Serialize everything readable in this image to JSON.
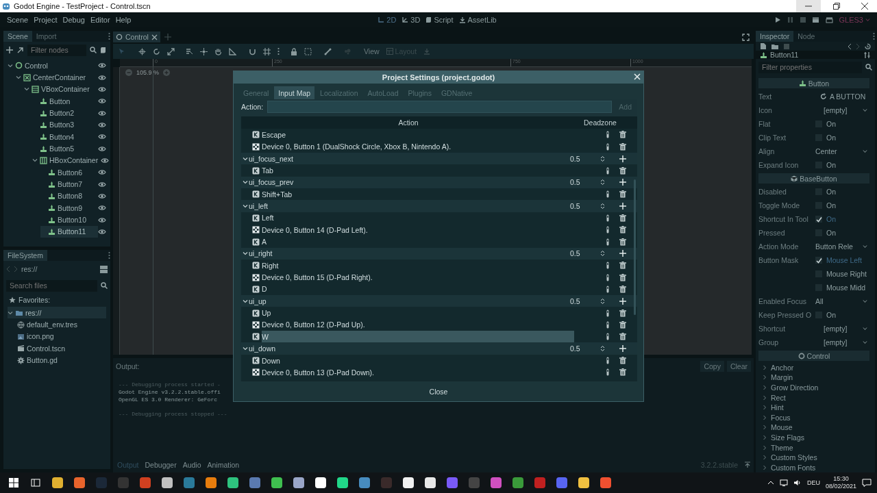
{
  "window": {
    "title": "Godot Engine - TestProject - Control.tscn"
  },
  "menu": [
    "Scene",
    "Project",
    "Debug",
    "Editor",
    "Help"
  ],
  "workspaces": [
    {
      "label": "2D",
      "kind": "planar",
      "selected": true
    },
    {
      "label": "3D",
      "kind": "spatial",
      "selected": false
    },
    {
      "label": "Script",
      "kind": "script",
      "selected": false
    },
    {
      "label": "AssetLib",
      "kind": "assetlib",
      "selected": false
    }
  ],
  "renderer": "GLES3",
  "scene_dock": {
    "tabs": [
      {
        "label": "Scene",
        "selected": true
      },
      {
        "label": "Import",
        "selected": false
      }
    ],
    "filter_placeholder": "Filter nodes",
    "tree": [
      {
        "label": "Control",
        "kind": "control",
        "selected": false,
        "expanded": true,
        "children": [
          {
            "label": "CenterContainer",
            "kind": "center",
            "selected": false,
            "expanded": true,
            "children": [
              {
                "label": "VBoxContainer",
                "kind": "vbox",
                "selected": false,
                "expanded": true,
                "children": [
                  {
                    "label": "Button",
                    "kind": "button",
                    "selected": false
                  },
                  {
                    "label": "Button2",
                    "kind": "button",
                    "selected": false
                  },
                  {
                    "label": "Button3",
                    "kind": "button",
                    "selected": false
                  },
                  {
                    "label": "Button4",
                    "kind": "button",
                    "selected": false
                  },
                  {
                    "label": "Button5",
                    "kind": "button",
                    "selected": false
                  },
                  {
                    "label": "HBoxContainer",
                    "kind": "hbox",
                    "selected": false,
                    "expanded": true,
                    "children": [
                      {
                        "label": "Button6",
                        "kind": "button",
                        "selected": false
                      },
                      {
                        "label": "Button7",
                        "kind": "button",
                        "selected": false
                      },
                      {
                        "label": "Button8",
                        "kind": "button",
                        "selected": false
                      },
                      {
                        "label": "Button9",
                        "kind": "button",
                        "selected": false
                      },
                      {
                        "label": "Button10",
                        "kind": "button",
                        "selected": false
                      },
                      {
                        "label": "Button11",
                        "kind": "button",
                        "selected": true
                      }
                    ]
                  }
                ]
              }
            ]
          }
        ]
      }
    ]
  },
  "filesystem": {
    "tab": "FileSystem",
    "path": "res://",
    "search_placeholder": "Search files",
    "favorites": "Favorites:",
    "tree": [
      {
        "label": "res://",
        "kind": "folder",
        "selected": true,
        "expanded": true,
        "children": [
          {
            "label": "default_env.tres",
            "kind": "env",
            "selected": false
          },
          {
            "label": "icon.png",
            "kind": "image",
            "selected": false
          },
          {
            "label": "Control.tscn",
            "kind": "scene",
            "selected": false
          },
          {
            "label": "Button.gd",
            "kind": "script",
            "selected": false
          }
        ]
      }
    ]
  },
  "scene_tabs": [
    {
      "label": "Control",
      "selected": true
    }
  ],
  "viewport": {
    "view": "View",
    "layout": "Layout",
    "zoom": "105.9 %",
    "ruler": [
      "0",
      "250",
      "750",
      "1000"
    ]
  },
  "output": {
    "title": "Output:",
    "buttons": [
      "Copy",
      "Clear"
    ],
    "lines": [
      {
        "kind": "comment",
        "text": "--- Debugging process started -"
      },
      {
        "kind": "plain",
        "text": "Godot Engine v3.2.2.stable.offi"
      },
      {
        "kind": "plain",
        "text": "OpenGL ES 3.0 Renderer: GeForc"
      },
      {
        "kind": "gap"
      },
      {
        "kind": "comment",
        "text": "--- Debugging process stopped ---"
      }
    ],
    "tabs": [
      {
        "label": "Output",
        "selected": true
      },
      {
        "label": "Debugger",
        "selected": false
      },
      {
        "label": "Audio",
        "selected": false
      },
      {
        "label": "Animation",
        "selected": false
      }
    ],
    "version": "3.2.2.stable"
  },
  "inspector": {
    "tabs": [
      {
        "label": "Inspector",
        "selected": true
      },
      {
        "label": "Node",
        "selected": false
      }
    ],
    "node": "Button11",
    "filter_placeholder": "Filter properties",
    "rows": [
      {
        "kind": "section",
        "label": "Button"
      },
      {
        "kind": "text",
        "label": "Text",
        "value": "A BUTTON"
      },
      {
        "kind": "dropdown",
        "label": "Icon",
        "value": "[empty]"
      },
      {
        "kind": "check",
        "label": "Flat",
        "value": "On",
        "checked": false
      },
      {
        "kind": "check",
        "label": "Clip Text",
        "value": "On",
        "checked": false
      },
      {
        "kind": "dropdown",
        "label": "Align",
        "value": "Center"
      },
      {
        "kind": "check",
        "label": "Expand Icon",
        "value": "On",
        "checked": false
      },
      {
        "kind": "section",
        "label": "BaseButton"
      },
      {
        "kind": "check",
        "label": "Disabled",
        "value": "On",
        "checked": false
      },
      {
        "kind": "check",
        "label": "Toggle Mode",
        "value": "On",
        "checked": false
      },
      {
        "kind": "check",
        "label": "Shortcut In Tool",
        "value": "On",
        "checked": true
      },
      {
        "kind": "check",
        "label": "Pressed",
        "value": "On",
        "checked": false
      },
      {
        "kind": "dropdown",
        "label": "Action Mode",
        "value": "Button Rele"
      },
      {
        "kind": "check",
        "label": "Button Mask",
        "value": "Mouse Left",
        "checked": true
      },
      {
        "kind": "check",
        "value": "Mouse Right",
        "checked": false
      },
      {
        "kind": "check",
        "value": "Mouse Midd",
        "checked": false
      },
      {
        "kind": "dropdown",
        "label": "Enabled Focus",
        "value": "All"
      },
      {
        "kind": "check",
        "label": "Keep Pressed O",
        "value": "On",
        "checked": false
      },
      {
        "kind": "dropdown",
        "label": "Shortcut",
        "value": "[empty]"
      },
      {
        "kind": "dropdown",
        "label": "Group",
        "value": "[empty]"
      },
      {
        "kind": "section",
        "label": "Control"
      },
      {
        "kind": "group",
        "label": "Anchor"
      },
      {
        "kind": "group",
        "label": "Margin"
      },
      {
        "kind": "group",
        "label": "Grow Direction"
      },
      {
        "kind": "group",
        "label": "Rect"
      },
      {
        "kind": "group",
        "label": "Hint"
      },
      {
        "kind": "group",
        "label": "Focus"
      },
      {
        "kind": "group",
        "label": "Mouse"
      },
      {
        "kind": "group",
        "label": "Size Flags"
      },
      {
        "kind": "group",
        "label": "Theme"
      },
      {
        "kind": "group",
        "label": "Custom Styles"
      },
      {
        "kind": "group",
        "label": "Custom Fonts"
      }
    ]
  },
  "dialog": {
    "title": "Project Settings (project.godot)",
    "tabs": [
      {
        "label": "General",
        "selected": false
      },
      {
        "label": "Input Map",
        "selected": true
      },
      {
        "label": "Localization",
        "selected": false
      },
      {
        "label": "AutoLoad",
        "selected": false
      },
      {
        "label": "Plugins",
        "selected": false
      },
      {
        "label": "GDNative",
        "selected": false
      }
    ],
    "action_label": "Action:",
    "add": "Add",
    "columns": [
      "Action",
      "Deadzone"
    ],
    "continued_events": [
      {
        "kind": "key",
        "label": "Escape",
        "selected": false
      },
      {
        "kind": "joypad",
        "label": "Device 0, Button 1 (DualShock Circle, Xbox B, Nintendo A).",
        "selected": false
      }
    ],
    "actions": [
      {
        "name": "ui_focus_next",
        "deadzone": "0.5",
        "expanded": true,
        "events": [
          {
            "kind": "key",
            "label": "Tab",
            "selected": false
          }
        ]
      },
      {
        "name": "ui_focus_prev",
        "deadzone": "0.5",
        "expanded": true,
        "events": [
          {
            "kind": "key",
            "label": "Shift+Tab",
            "selected": false
          }
        ]
      },
      {
        "name": "ui_left",
        "deadzone": "0.5",
        "expanded": true,
        "events": [
          {
            "kind": "key",
            "label": "Left",
            "selected": false
          },
          {
            "kind": "joypad",
            "label": "Device 0, Button 14 (D-Pad Left).",
            "selected": false
          },
          {
            "kind": "key",
            "label": "A",
            "selected": false
          }
        ]
      },
      {
        "name": "ui_right",
        "deadzone": "0.5",
        "expanded": true,
        "events": [
          {
            "kind": "key",
            "label": "Right",
            "selected": false
          },
          {
            "kind": "joypad",
            "label": "Device 0, Button 15 (D-Pad Right).",
            "selected": false
          },
          {
            "kind": "key",
            "label": "D",
            "selected": false
          }
        ]
      },
      {
        "name": "ui_up",
        "deadzone": "0.5",
        "expanded": true,
        "events": [
          {
            "kind": "key",
            "label": "Up",
            "selected": false
          },
          {
            "kind": "joypad",
            "label": "Device 0, Button 12 (D-Pad Up).",
            "selected": false
          },
          {
            "kind": "key",
            "label": "W",
            "selected": true
          }
        ]
      },
      {
        "name": "ui_down",
        "deadzone": "0.5",
        "expanded": true,
        "events": [
          {
            "kind": "key",
            "label": "Down",
            "selected": false
          },
          {
            "kind": "joypad",
            "label": "Device 0, Button 13 (D-Pad Down).",
            "selected": false
          }
        ]
      }
    ],
    "close": "Close"
  },
  "taskbar": {
    "apps": [
      {
        "color": "#e0b030"
      },
      {
        "color": "#e8642c"
      },
      {
        "color": "#1b2838"
      },
      {
        "color": "#333333"
      },
      {
        "color": "#d04020"
      },
      {
        "color": "#c0c0c0"
      },
      {
        "color": "#2a7a9a"
      },
      {
        "color": "#e87d0d"
      },
      {
        "color": "#2ec27e"
      },
      {
        "color": "#5a7ab0"
      },
      {
        "color": "#3fbf4f"
      },
      {
        "color": "#9aa6c8"
      },
      {
        "color": "#ffffff"
      },
      {
        "color": "#21d789"
      },
      {
        "color": "#478cbf"
      },
      {
        "color": "#3a2a2a"
      },
      {
        "color": "#f0f0f0"
      },
      {
        "color": "#e8e8e8"
      },
      {
        "color": "#7a5af8"
      },
      {
        "color": "#444444"
      },
      {
        "color": "#d050c0"
      },
      {
        "color": "#3a9a3a"
      },
      {
        "color": "#c02020"
      },
      {
        "color": "#5865f2"
      },
      {
        "color": "#f0c040"
      },
      {
        "color": "#f05030"
      }
    ],
    "language": "DEU",
    "time": "15:30",
    "date": "08/02/2021"
  }
}
